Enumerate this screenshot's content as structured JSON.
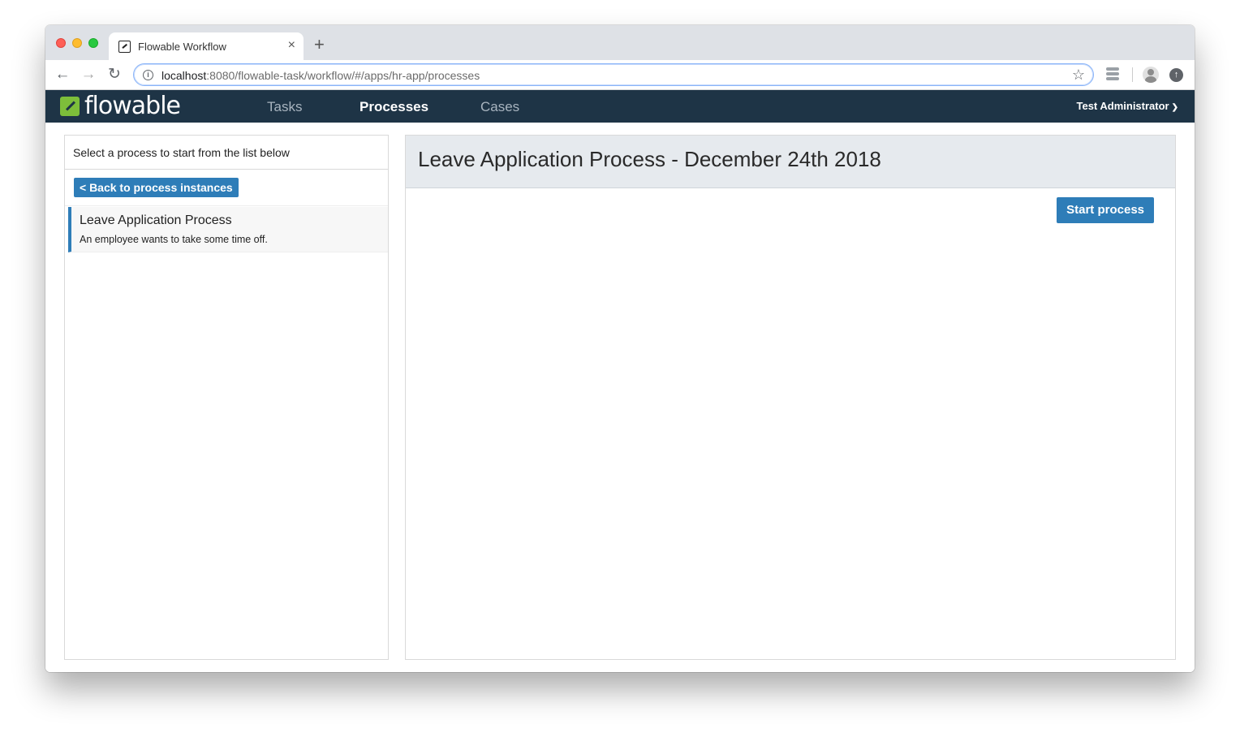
{
  "browser": {
    "tab_title": "Flowable Workflow",
    "tab_close": "×",
    "new_tab": "+",
    "url_host": "localhost",
    "url_rest": ":8080/flowable-task/workflow/#/apps/hr-app/processes"
  },
  "appnav": {
    "logo_text": "flowable",
    "links": {
      "tasks": "Tasks",
      "processes": "Processes",
      "cases": "Cases"
    },
    "active": "processes",
    "user": "Test Administrator"
  },
  "left_panel": {
    "header": "Select a process to start from the list below",
    "back_button": "< Back to process instances",
    "processes": [
      {
        "name": "Leave Application Process",
        "description": "An employee wants to take some time off."
      }
    ]
  },
  "right_panel": {
    "title": "Leave Application Process - December 24th 2018",
    "start_button": "Start process"
  },
  "colors": {
    "nav_bg": "#1e3446",
    "brand_green": "#7dbe3a",
    "primary_button": "#2e7db8",
    "panel_header_bg": "#e6eaee"
  }
}
